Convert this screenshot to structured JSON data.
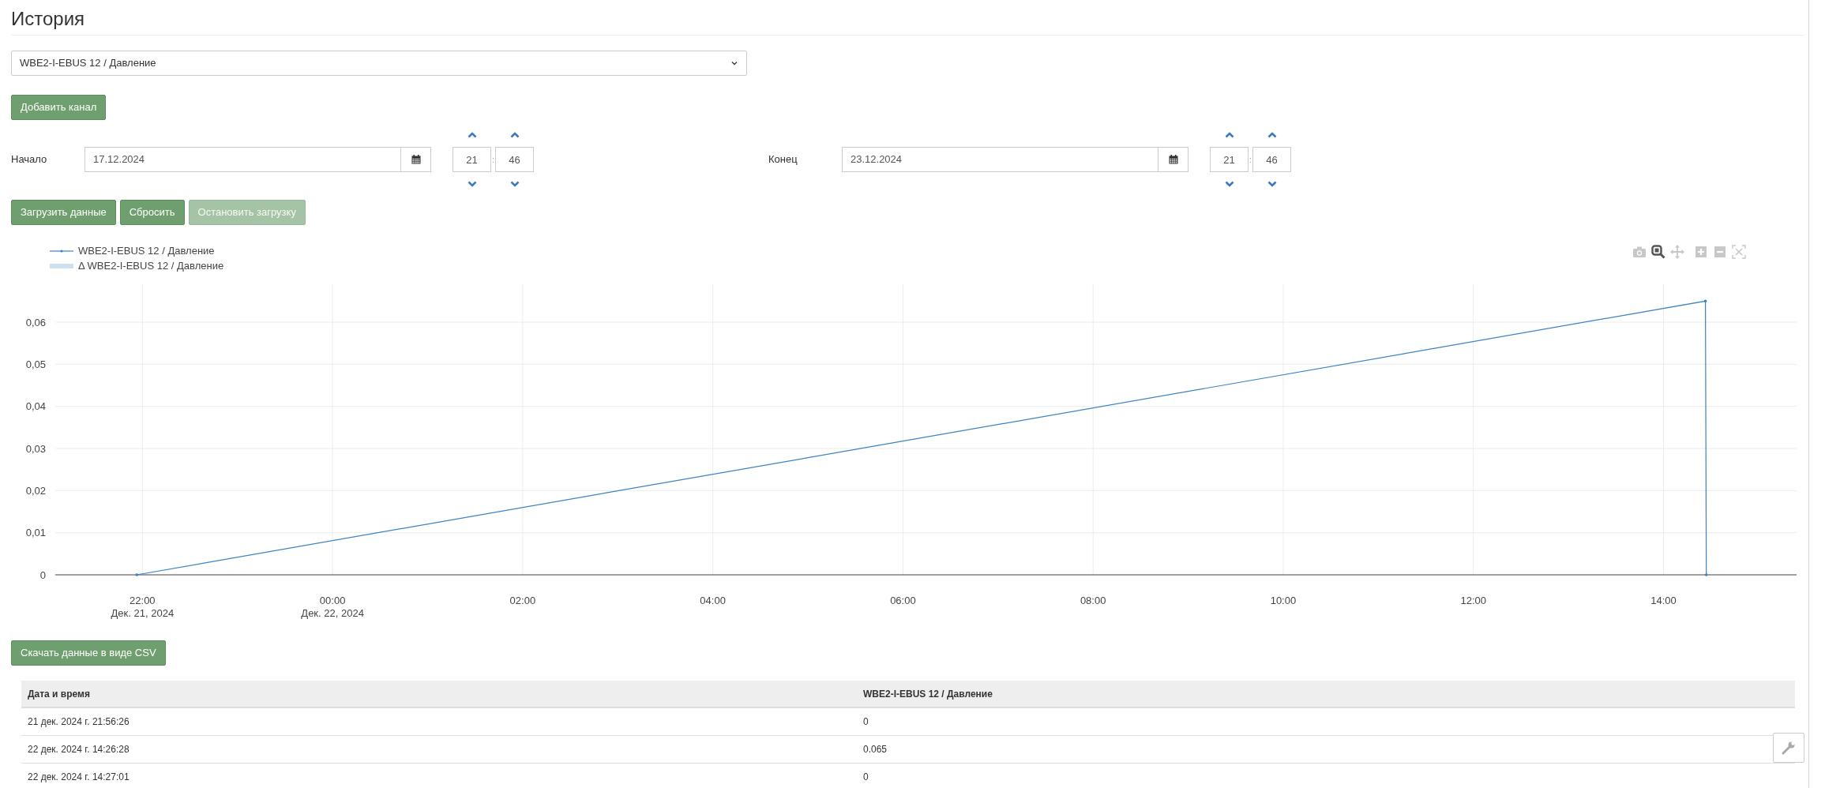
{
  "page_title": "История",
  "channel_select": {
    "value": "WBE2-I-EBUS 12 / Давление"
  },
  "add_channel_button": "Добавить канал",
  "range": [
    {
      "label": "Начало",
      "date": "17.12.2024",
      "hours": "21",
      "separator": ":",
      "minutes": "46"
    },
    {
      "label": "Конец",
      "date": "23.12.2024",
      "hours": "21",
      "separator": ":",
      "minutes": "46"
    }
  ],
  "actions": [
    {
      "label": "Загрузить данные",
      "disabled": false
    },
    {
      "label": "Сбросить",
      "disabled": false
    },
    {
      "label": "Остановить загрузку",
      "disabled": true
    }
  ],
  "chart": {
    "legend": [
      {
        "kind": "line"
      },
      {
        "label": "Δ WBE2-I-EBUS 12 / Давление",
        "kind": "band"
      }
    ],
    "toolbar": [
      {
        "kind": "camera",
        "selected": false
      },
      {
        "kind": "zoom",
        "selected": true
      },
      {
        "kind": "pan",
        "selected": false
      },
      {
        "kind": "zoom_in",
        "selected": false
      },
      {
        "kind": "zoom_out",
        "selected": false
      },
      {
        "kind": "autoscale",
        "selected": false
      }
    ],
    "chart_data": {
      "type": "line",
      "x": [
        "2024-12-21T21:56:26",
        "2024-12-22T14:26:28",
        "2024-12-22T14:27:01"
      ],
      "series": [
        {
          "name": "WBE2-I-EBUS 12 / Давление",
          "color": "#3b82c4",
          "values": [
            0,
            0.065,
            0
          ]
        }
      ],
      "xlim": [
        "2024-12-21T21:05:00",
        "2024-12-22T15:24:00"
      ],
      "ylim": [
        0,
        0.069
      ],
      "grid": true,
      "xticks": [
        {
          "value": "2024-12-21T22:00:00",
          "label": "22:00\nДек. 21, 2024"
        },
        {
          "value": "2024-12-22T00:00:00",
          "label": "00:00\nДек. 22, 2024"
        },
        {
          "value": "2024-12-22T02:00:00",
          "label": "02:00"
        },
        {
          "value": "2024-12-22T04:00:00",
          "label": "04:00"
        },
        {
          "value": "2024-12-22T06:00:00",
          "label": "06:00"
        },
        {
          "value": "2024-12-22T08:00:00",
          "label": "08:00"
        },
        {
          "value": "2024-12-22T10:00:00",
          "label": "10:00"
        },
        {
          "value": "2024-12-22T12:00:00",
          "label": "12:00"
        },
        {
          "value": "2024-12-22T14:00:00",
          "label": "14:00"
        }
      ],
      "yticks": [
        {
          "value": 0,
          "label": "0"
        },
        {
          "value": 0.01,
          "label": "0,01"
        },
        {
          "value": 0.02,
          "label": "0,02"
        },
        {
          "value": 0.03,
          "label": "0,03"
        },
        {
          "value": 0.04,
          "label": "0,04"
        },
        {
          "value": 0.05,
          "label": "0,05"
        },
        {
          "value": 0.06,
          "label": "0,06"
        }
      ]
    }
  },
  "csv_button": "Скачать данные в виде CSV",
  "table": {
    "columns": [
      "Дата и время",
      "WBE2-I-EBUS 12 / Давление"
    ],
    "rows": [
      [
        "21 дек. 2024 г. 21:56:26",
        "0"
      ],
      [
        "22 дек. 2024 г. 14:26:28",
        "0.065"
      ],
      [
        "22 дек. 2024 г. 14:27:01",
        "0"
      ]
    ]
  }
}
